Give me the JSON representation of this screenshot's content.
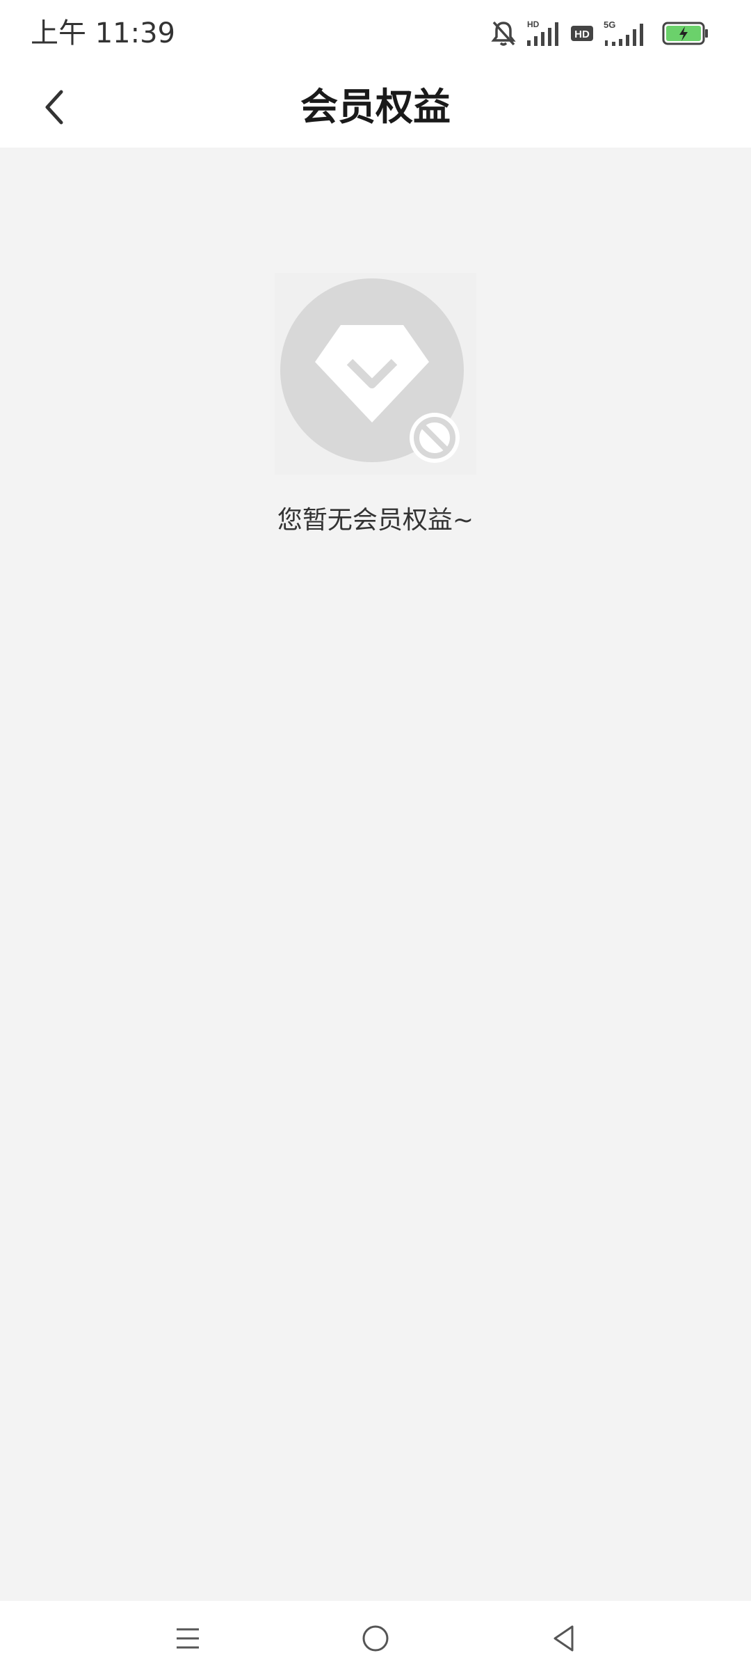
{
  "status_bar": {
    "time": "上午 11:39",
    "hd_label_1": "HD",
    "hd_label_2": "HD",
    "network_label": "5G",
    "battery_color": "#6bd16b"
  },
  "header": {
    "title": "会员权益",
    "back_icon": "chevron-left-icon"
  },
  "empty_state": {
    "illustration_icon": "diamond-disabled-icon",
    "message": "您暂无会员权益~"
  },
  "navigation_bar": {
    "menu_icon": "menu-icon",
    "home_icon": "home-circle-icon",
    "back_icon": "triangle-back-icon"
  },
  "colors": {
    "background": "#f3f3f3",
    "surface": "#ffffff",
    "illustration_gray": "#d8d8d8",
    "text_primary": "#1a1a1a"
  }
}
